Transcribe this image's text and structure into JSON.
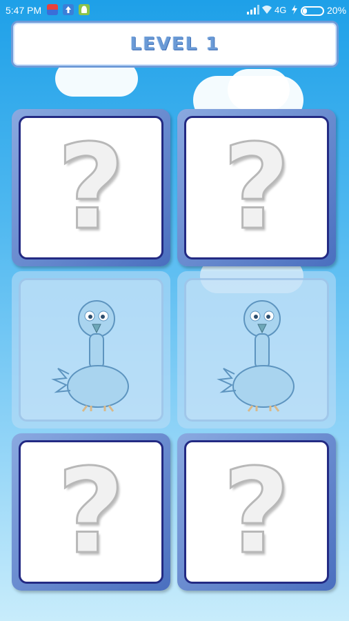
{
  "status_bar": {
    "time": "5:47 PM",
    "network": "4G",
    "battery_percent": "20%",
    "battery_level": 0.2,
    "icons": [
      "app-notification-icon",
      "upload-icon",
      "android-icon",
      "signal-icon",
      "wifi-icon",
      "charging-icon",
      "battery-icon"
    ]
  },
  "header": {
    "level_title": "LEVEL 1"
  },
  "board": {
    "cards": [
      {
        "state": "hidden",
        "face": "question-mark-icon",
        "symbol": "?"
      },
      {
        "state": "hidden",
        "face": "question-mark-icon",
        "symbol": "?"
      },
      {
        "state": "revealed",
        "face": "bird-icon",
        "symbol": ""
      },
      {
        "state": "revealed",
        "face": "bird-icon",
        "symbol": ""
      },
      {
        "state": "hidden",
        "face": "question-mark-icon",
        "symbol": "?"
      },
      {
        "state": "hidden",
        "face": "question-mark-icon",
        "symbol": "?"
      }
    ]
  },
  "colors": {
    "sky_top": "#1ea0e8",
    "sky_bottom": "#c8ecfb",
    "card_frame": "#4a6fbf",
    "card_border": "#232a83",
    "title_text": "#6a9ad6"
  }
}
